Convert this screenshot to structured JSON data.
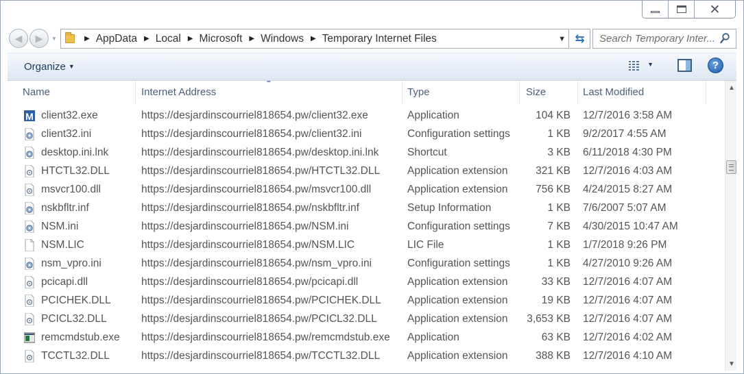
{
  "window": {
    "caption_buttons": [
      "minimize",
      "maximize",
      "close"
    ]
  },
  "address_bar": {
    "breadcrumbs": [
      "AppData",
      "Local",
      "Microsoft",
      "Windows",
      "Temporary Internet Files"
    ]
  },
  "search": {
    "placeholder": "Search Temporary Inter..."
  },
  "toolbar": {
    "organize_label": "Organize"
  },
  "columns": {
    "name": "Name",
    "address": "Internet Address",
    "type": "Type",
    "size": "Size",
    "modified": "Last Modified"
  },
  "files": [
    {
      "name": "client32.exe",
      "address": "https://desjardinscourriel818654.pw/client32.exe",
      "type": "Application",
      "size": "104 KB",
      "modified": "12/7/2016 3:58 AM",
      "icon": "app-m-icon"
    },
    {
      "name": "client32.ini",
      "address": "https://desjardinscourriel818654.pw/client32.ini",
      "type": "Configuration settings",
      "size": "1 KB",
      "modified": "9/2/2017 4:55 AM",
      "icon": "settings-file-icon"
    },
    {
      "name": "desktop.ini.lnk",
      "address": "https://desjardinscourriel818654.pw/desktop.ini.lnk",
      "type": "Shortcut",
      "size": "3 KB",
      "modified": "6/11/2018 4:30 PM",
      "icon": "settings-file-icon"
    },
    {
      "name": "HTCTL32.DLL",
      "address": "https://desjardinscourriel818654.pw/HTCTL32.DLL",
      "type": "Application extension",
      "size": "321 KB",
      "modified": "12/7/2016 4:03 AM",
      "icon": "dll-file-icon"
    },
    {
      "name": "msvcr100.dll",
      "address": "https://desjardinscourriel818654.pw/msvcr100.dll",
      "type": "Application extension",
      "size": "756 KB",
      "modified": "4/24/2015 8:27 AM",
      "icon": "dll-file-icon"
    },
    {
      "name": "nskbfltr.inf",
      "address": "https://desjardinscourriel818654.pw/nskbfltr.inf",
      "type": "Setup Information",
      "size": "1 KB",
      "modified": "7/6/2007 5:07 AM",
      "icon": "settings-file-icon"
    },
    {
      "name": "NSM.ini",
      "address": "https://desjardinscourriel818654.pw/NSM.ini",
      "type": "Configuration settings",
      "size": "7 KB",
      "modified": "4/30/2015 10:47 AM",
      "icon": "settings-file-icon"
    },
    {
      "name": "NSM.LIC",
      "address": "https://desjardinscourriel818654.pw/NSM.LIC",
      "type": "LIC File",
      "size": "1 KB",
      "modified": "1/7/2018 9:26 PM",
      "icon": "blank-file-icon"
    },
    {
      "name": "nsm_vpro.ini",
      "address": "https://desjardinscourriel818654.pw/nsm_vpro.ini",
      "type": "Configuration settings",
      "size": "1 KB",
      "modified": "4/27/2010 9:26 AM",
      "icon": "settings-file-icon"
    },
    {
      "name": "pcicapi.dll",
      "address": "https://desjardinscourriel818654.pw/pcicapi.dll",
      "type": "Application extension",
      "size": "33 KB",
      "modified": "12/7/2016 4:07 AM",
      "icon": "dll-file-icon"
    },
    {
      "name": "PCICHEK.DLL",
      "address": "https://desjardinscourriel818654.pw/PCICHEK.DLL",
      "type": "Application extension",
      "size": "19 KB",
      "modified": "12/7/2016 4:07 AM",
      "icon": "dll-file-icon"
    },
    {
      "name": "PCICL32.DLL",
      "address": "https://desjardinscourriel818654.pw/PCICL32.DLL",
      "type": "Application extension",
      "size": "3,653 KB",
      "modified": "12/7/2016 4:07 AM",
      "icon": "dll-file-icon"
    },
    {
      "name": "remcmdstub.exe",
      "address": "https://desjardinscourriel818654.pw/remcmdstub.exe",
      "type": "Application",
      "size": "63 KB",
      "modified": "12/7/2016 4:02 AM",
      "icon": "console-app-icon"
    },
    {
      "name": "TCCTL32.DLL",
      "address": "https://desjardinscourriel818654.pw/TCCTL32.DLL",
      "type": "Application extension",
      "size": "388 KB",
      "modified": "12/7/2016 4:10 AM",
      "icon": "dll-file-icon"
    }
  ]
}
